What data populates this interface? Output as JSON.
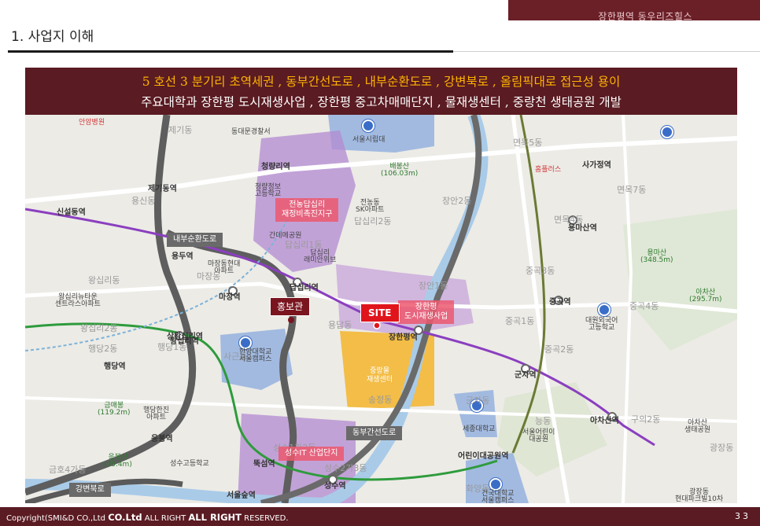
{
  "header": {
    "brand": "장한평역 동우리즈힐스",
    "section_title": "1. 사업지 이해"
  },
  "banner": {
    "line1": "5 호선 3 분기리 초역세권 , 동부간선도로 , 내부순환도로 , 강변북로 , 올림픽대로 접근성 용이",
    "line2": "주요대학과 장한평 도시재생사업 , 장한평 중고차매매단지 , 물재생센터 , 중랑천 생태공원 개발"
  },
  "map": {
    "roads": {
      "inner_ring": "내부순환도로",
      "east_arterial": "동부간선도로",
      "gangbyeon": "강변북로"
    },
    "zones": {
      "jeonnong": "전농답십리\n재정비촉진지구",
      "janghanpyeong": "장한평\n도시재생사업",
      "jungnang_water": "중랑물\n재생센터",
      "seongsu_it": "성수IT 산업단지"
    },
    "site_label": "SITE",
    "pr_label": "홍보관",
    "stations": {
      "janghanpyeong": "장한평역",
      "dapsimni": "답십리역",
      "majang": "마장역",
      "wangsimni": "왕십리역",
      "cheongnyangni": "청량리역",
      "jegidong": "제기동역",
      "sinseoldong": "신설동역",
      "yongdu": "용두역",
      "gunja": "군자역",
      "achasan": "아차산역",
      "junggok": "중곡역",
      "seongsu": "성수역",
      "ttukseom": "뚝섬역",
      "seoulsup": "서울숲역",
      "sagajeong": "사가정역",
      "yongmasan": "용마산역",
      "eorini": "어린이대공원역",
      "sangwangsimni": "상왕십리역",
      "haengdang": "행당역",
      "eungbong": "응봉역"
    },
    "places": {
      "seoulsirip": "서울시립대",
      "hanyang": "한양대학교\n서울캠퍼스",
      "sejong": "세종대학교",
      "konkuk": "건국대학교\n서울캠퍼스",
      "childpark": "서울어린이\n대공원",
      "hufs": "대원외국어\n고등학교",
      "baebongsan": "배봉산\n(106.03m)",
      "yongmasan_mt": "용마산\n(348.5m)",
      "achasan_mt": "아차산\n(295.7m)",
      "eungbongsan": "응봉산\n(95.4m)",
      "keummaebong": "금매봉\n(119.2m)",
      "dapsimni_raemian": "답십리\n래미안위브",
      "majang_apt": "마장동현대\n아파트",
      "seongsu_high": "성수고등학교",
      "dongdaemun_police": "동대문경찰서",
      "cheongnyangni_hs": "청량정보\n고등학교",
      "ganjeong": "간데메공원",
      "jeonnong_sk": "전농동\nSK아파트",
      "wangsimni_apt": "왕십리뉴타운\n센트라스아파트",
      "haengdang_apt": "행당한진\n아파트",
      "achasan_park": "아차산\n생태공원",
      "gwangnaru_10": "광장동\n현대파크빌10차",
      "homeplus": "홈플러스",
      "anam": "안암병원"
    },
    "districts": {
      "jegi": "제기동",
      "yongsin": "용신동",
      "dapsimni1": "답십리1동",
      "dapsimni2": "답십리2동",
      "jangan1": "장안1동",
      "jangan2": "장안2동",
      "majang": "마장동",
      "wangsimni": "왕십리동",
      "wangsimni2": "왕십리2동",
      "haengdang1": "행당1동",
      "haengdang2": "행당2동",
      "yongdap": "용답동",
      "songjeong": "송정동",
      "gunja": "군자동",
      "junggok1": "중곡1동",
      "junggok2": "중곡2동",
      "junggok3": "중곡3동",
      "junggok4": "중곡4동",
      "myeonmok4": "면목4동",
      "myeonmok5": "면목5동",
      "myeonmok7": "면목7동",
      "guui2": "구의2동",
      "neung": "능동",
      "seongsu1ga2": "성수1가2동",
      "seongsu2ga3": "성수2가3동",
      "geumho4ga": "금호4가동",
      "hwayang": "화양동",
      "gwangjang": "광장동",
      "sageunri": "사근동"
    }
  },
  "footer": {
    "copyright_pre": "Copyright(SMI&D CO.,Ltd ",
    "copyright_bold1": "CO.Ltd",
    "copyright_mid": " ALL RIGHT ",
    "copyright_bold2": "ALL RIGHT",
    "copyright_post": " RESERVED.",
    "page": "33"
  },
  "colors": {
    "maroon": "#5a1b22",
    "accent_yellow": "#ffb400",
    "site_red": "#e0151c",
    "zone_purple": "#b28ad0",
    "zone_orange": "#f5b52a",
    "line5_purple": "#8b3fbf"
  }
}
